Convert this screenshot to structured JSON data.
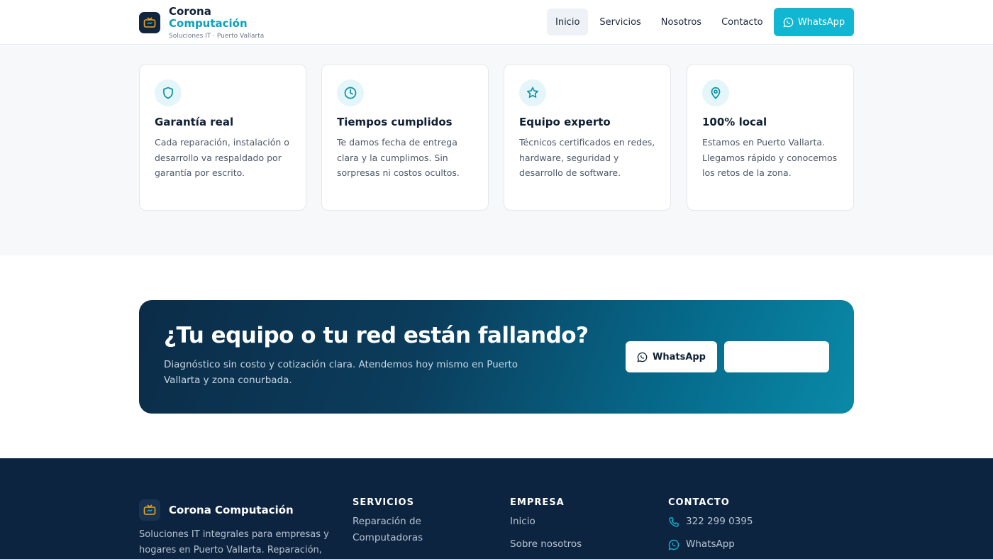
{
  "header": {
    "brand_line1": "Corona",
    "brand_line2": "Computación",
    "tagline": "Soluciones IT · Puerto Vallarta",
    "nav": [
      "Inicio",
      "Servicios",
      "Nosotros",
      "Contacto"
    ],
    "active_nav": "Inicio",
    "whatsapp_label": "WhatsApp"
  },
  "features": [
    {
      "icon": "shield-icon",
      "title": "Garantía real",
      "text": "Cada reparación, instalación o desarrollo va respaldado por garantía por escrito."
    },
    {
      "icon": "clock-icon",
      "title": "Tiempos cumplidos",
      "text": "Te damos fecha de entrega clara y la cumplimos. Sin sorpresas ni costos ocultos."
    },
    {
      "icon": "star-icon",
      "title": "Equipo experto",
      "text": "Técnicos certificados en redes, hardware, seguridad y desarrollo de software."
    },
    {
      "icon": "map-pin-icon",
      "title": "100% local",
      "text": "Estamos en Puerto Vallarta. Llegamos rápido y conocemos los retos de la zona."
    }
  ],
  "cta": {
    "title": "¿Tu equipo o tu red están fallando?",
    "text": "Diagnóstico sin costo y cotización clara. Atendemos hoy mismo en Puerto Vallarta y zona conurbada.",
    "whatsapp_label": "WhatsApp",
    "second_label": ""
  },
  "footer": {
    "brand": "Corona Computación",
    "description": "Soluciones IT integrales para empresas y hogares en Puerto Vallarta. Reparación,",
    "services_heading": "SERVICIOS",
    "services": [
      "Reparación de Computadoras"
    ],
    "company_heading": "EMPRESA",
    "company": [
      "Inicio",
      "Sobre nosotros"
    ],
    "contact_heading": "CONTACTO",
    "phone": "322 299 0395",
    "whatsapp": "WhatsApp"
  },
  "colors": {
    "accent": "#10b6d2",
    "navy": "#0d2440",
    "icon_stroke": "#0a8fa8"
  }
}
